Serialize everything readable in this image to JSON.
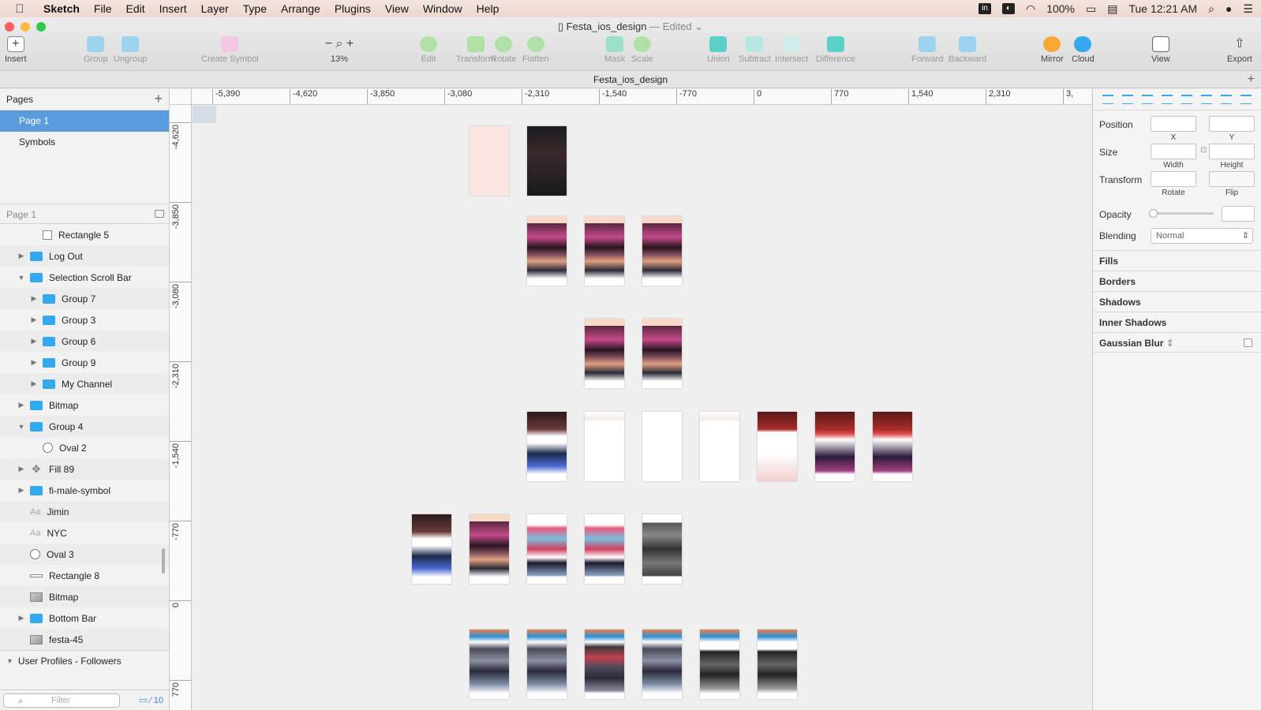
{
  "menubar": {
    "apple": "",
    "items": [
      "Sketch",
      "File",
      "Edit",
      "Insert",
      "Layer",
      "Type",
      "Arrange",
      "Plugins",
      "View",
      "Window",
      "Help"
    ],
    "status": {
      "battery": "100%",
      "datetime": "Tue 12:21 AM"
    }
  },
  "window": {
    "title": "Festa_ios_design",
    "edited": "— Edited",
    "tab_title": "Festa_ios_design"
  },
  "toolbar": {
    "insert": "Insert",
    "group": "Group",
    "ungroup": "Ungroup",
    "create_symbol": "Create Symbol",
    "zoom_level": "13%",
    "edit": "Edit",
    "transform": "Transform",
    "rotate": "Rotate",
    "flatten": "Flatten",
    "mask": "Mask",
    "scale": "Scale",
    "union": "Union",
    "subtract": "Subtract",
    "intersect": "Intersect",
    "difference": "Difference",
    "forward": "Forward",
    "backward": "Backward",
    "mirror": "Mirror",
    "cloud": "Cloud",
    "view": "View",
    "export": "Export"
  },
  "sidebar": {
    "pages_header": "Pages",
    "pages": [
      "Page 1",
      "Symbols"
    ],
    "layers_header": "Page 1",
    "layers": [
      {
        "label": "Rectangle 5",
        "type": "rect",
        "depth": 2,
        "tri": ""
      },
      {
        "label": "Log Out",
        "type": "folder",
        "depth": 1,
        "tri": "closed"
      },
      {
        "label": "Selection Scroll Bar",
        "type": "folder",
        "depth": 1,
        "tri": "open"
      },
      {
        "label": "Group 7",
        "type": "folder",
        "depth": 2,
        "tri": "closed"
      },
      {
        "label": "Group 3",
        "type": "folder",
        "depth": 2,
        "tri": "closed"
      },
      {
        "label": "Group 6",
        "type": "folder",
        "depth": 2,
        "tri": "closed"
      },
      {
        "label": "Group 9",
        "type": "folder",
        "depth": 2,
        "tri": "closed"
      },
      {
        "label": "My Channel",
        "type": "folder",
        "depth": 2,
        "tri": "closed"
      },
      {
        "label": "Bitmap",
        "type": "folder",
        "depth": 1,
        "tri": "closed"
      },
      {
        "label": "Group 4",
        "type": "folder",
        "depth": 1,
        "tri": "open"
      },
      {
        "label": "Oval 2",
        "type": "oval",
        "depth": 2,
        "tri": ""
      },
      {
        "label": "Fill 89",
        "type": "symbol",
        "depth": 1,
        "tri": "closed"
      },
      {
        "label": "fi-male-symbol",
        "type": "folder",
        "depth": 1,
        "tri": "closed"
      },
      {
        "label": "Jimin",
        "type": "text",
        "depth": 1,
        "tri": ""
      },
      {
        "label": "NYC",
        "type": "text",
        "depth": 1,
        "tri": ""
      },
      {
        "label": "Oval 3",
        "type": "oval",
        "depth": 1,
        "tri": ""
      },
      {
        "label": "Rectangle 8",
        "type": "line",
        "depth": 1,
        "tri": ""
      },
      {
        "label": "Bitmap",
        "type": "image",
        "depth": 1,
        "tri": ""
      },
      {
        "label": "Bottom Bar",
        "type": "folder",
        "depth": 1,
        "tri": "closed"
      },
      {
        "label": "festa-45",
        "type": "image",
        "depth": 1,
        "tri": ""
      }
    ],
    "collection": "User Profiles - Followers",
    "filter_placeholder": "Filter",
    "filter_count": "10"
  },
  "rulers": {
    "h": [
      "-5,390",
      "-4,620",
      "-3,850",
      "-3,080",
      "-2,310",
      "-1,540",
      "-770",
      "0",
      "770",
      "1,540",
      "2,310",
      "3,"
    ],
    "v": [
      "-4,620",
      "-3,850",
      "-3,080",
      "-2,310",
      "-1,540",
      "-770",
      "0",
      "770"
    ]
  },
  "inspector": {
    "position": "Position",
    "x": "X",
    "y": "Y",
    "size": "Size",
    "width": "Width",
    "height": "Height",
    "transform": "Transform",
    "rotate": "Rotate",
    "flip": "Flip",
    "opacity": "Opacity",
    "blending": "Blending",
    "blending_value": "Normal",
    "sections": [
      "Fills",
      "Borders",
      "Shadows",
      "Inner Shadows",
      "Gaussian Blur"
    ]
  },
  "artboards": [
    {
      "style": "ab-pink"
    },
    {
      "style": "ab-dark"
    },
    {
      "style": "ab-concert"
    },
    {
      "style": "ab-concert"
    },
    {
      "style": "ab-concert"
    },
    {
      "style": "ab-concert"
    },
    {
      "style": "ab-concert"
    },
    {
      "style": "ab-dark2"
    },
    {
      "style": "ab-form"
    },
    {
      "style": "ab-white"
    },
    {
      "style": "ab-form"
    },
    {
      "style": "ab-red"
    },
    {
      "style": "ab-red2"
    },
    {
      "style": "ab-red2"
    },
    {
      "style": "ab-dark2"
    },
    {
      "style": "ab-concert"
    },
    {
      "style": "ab-collage"
    },
    {
      "style": "ab-collage"
    },
    {
      "style": "ab-grid"
    },
    {
      "style": "ab-blue"
    },
    {
      "style": "ab-blue"
    },
    {
      "style": "ab-blue2"
    },
    {
      "style": "ab-blue"
    },
    {
      "style": "ab-blue3"
    },
    {
      "style": "ab-blue3"
    }
  ]
}
